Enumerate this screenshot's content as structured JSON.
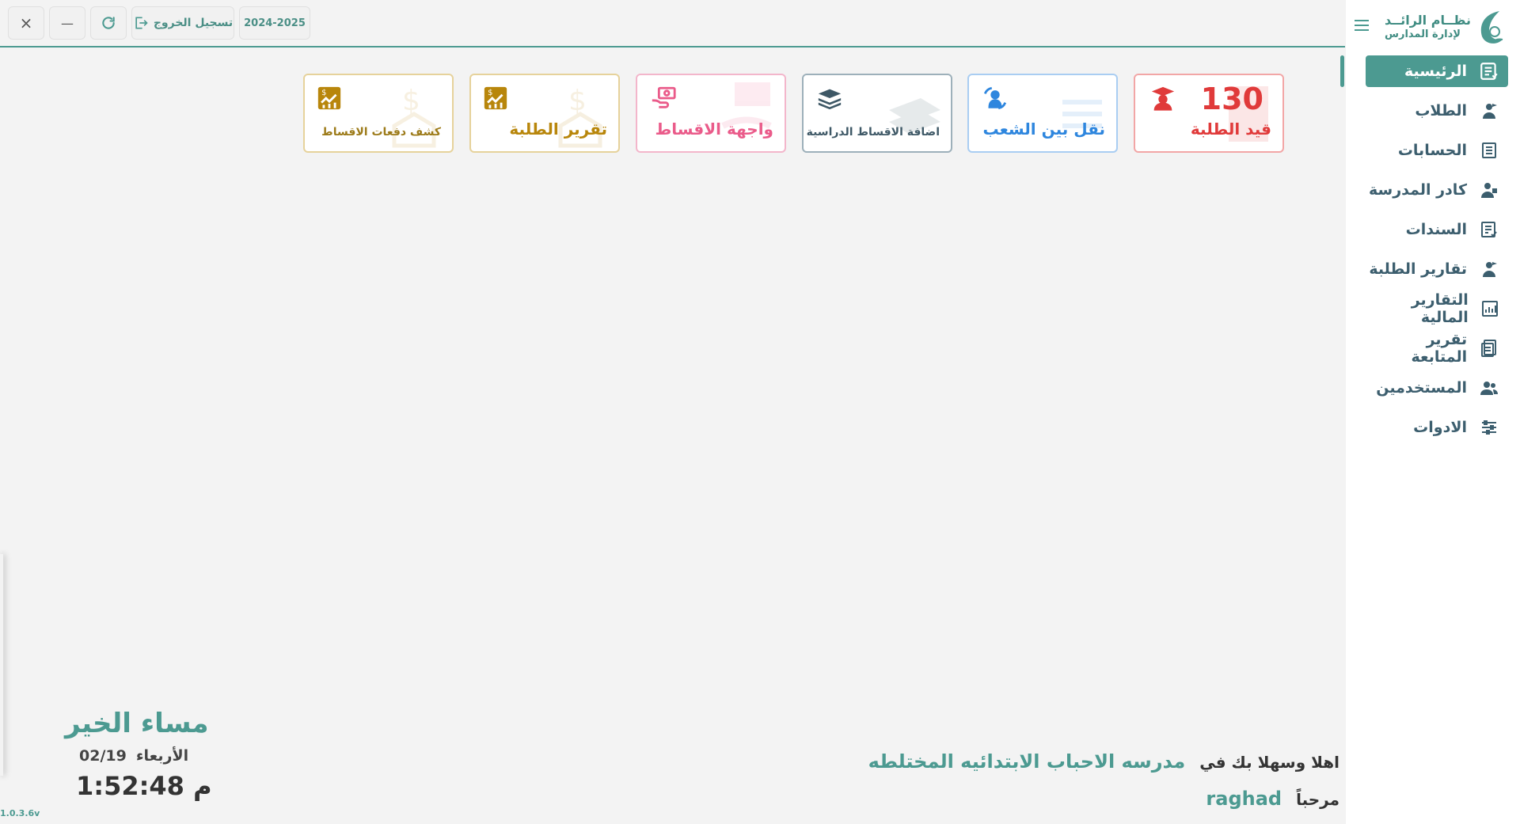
{
  "header": {
    "close_label": "×",
    "minimize_label": "—",
    "logout_label": "تسجيل الخروج",
    "year_label": "2024-2025"
  },
  "logo": {
    "line1": "نظــام الرائــد",
    "line2": "لإدارة المدارس"
  },
  "sidebar": {
    "items": [
      {
        "label": "الرئيسية",
        "icon": "home-list-icon"
      },
      {
        "label": "الطلاب",
        "icon": "student-icon"
      },
      {
        "label": "الحسابات",
        "icon": "accounts-icon"
      },
      {
        "label": "كادر المدرسة",
        "icon": "staff-icon"
      },
      {
        "label": "السندات",
        "icon": "receipts-icon"
      },
      {
        "label": "تقارير الطلبة",
        "icon": "student-reports-icon"
      },
      {
        "label": "التقارير المالية",
        "icon": "financial-reports-icon"
      },
      {
        "label": "تقرير المتابعة",
        "icon": "followup-report-icon"
      },
      {
        "label": "المستخدمين",
        "icon": "users-icon"
      },
      {
        "label": "الادوات",
        "icon": "tools-icon"
      }
    ]
  },
  "tiles": [
    {
      "label": "قيد الطلبة",
      "number": "130",
      "color": "#e03a3a",
      "icon": "graduate-icon"
    },
    {
      "label": "نقل بين الشعب",
      "color": "#2e86de",
      "icon": "transfer-icon"
    },
    {
      "label": "اضافة الاقساط الدراسية",
      "color": "#3e5866",
      "icon": "money-stack-icon"
    },
    {
      "label": "واجهة الاقساط",
      "color": "#ea5b8a",
      "icon": "hand-money-icon"
    },
    {
      "label": "تقرير الطلبة",
      "color": "#b8860b",
      "icon": "report-chart-icon"
    },
    {
      "label": "كشف دفعات الاقساط",
      "color": "#b8860b",
      "icon": "report-chart-icon"
    }
  ],
  "footer": {
    "greeting": "مساء الخير",
    "day": "الأربعاء",
    "date": "02/19",
    "time": "1:52:48 م",
    "version": "1.0.3.6v",
    "welcome_prefix": "اهلا وسهلا بك في",
    "school_name": "مدرسه الاحباب الابتدائيه المختلطه",
    "hello_prefix": "مرحباً",
    "username": "raghad"
  },
  "colors": {
    "accent": "#4c9a91"
  }
}
